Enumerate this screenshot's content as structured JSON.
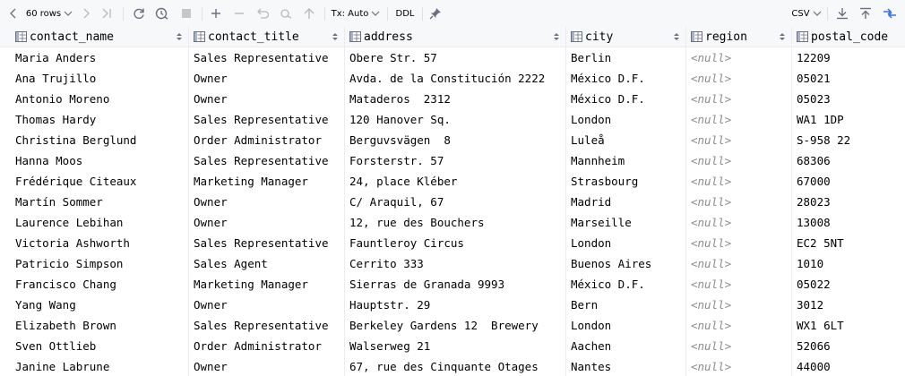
{
  "toolbar": {
    "rows_label": "60 rows",
    "tx_label": "Tx: Auto",
    "ddl_label": "DDL",
    "export_format": "CSV"
  },
  "columns": [
    {
      "name": "contact_name"
    },
    {
      "name": "contact_title"
    },
    {
      "name": "address"
    },
    {
      "name": "city"
    },
    {
      "name": "region"
    },
    {
      "name": "postal_code"
    }
  ],
  "rows": [
    [
      "Maria Anders",
      "Sales Representative",
      "Obere Str. 57",
      "Berlin",
      "<null>",
      "12209"
    ],
    [
      "Ana Trujillo",
      "Owner",
      "Avda. de la Constitución 2222",
      "México D.F.",
      "<null>",
      "05021"
    ],
    [
      "Antonio Moreno",
      "Owner",
      "Mataderos  2312",
      "México D.F.",
      "<null>",
      "05023"
    ],
    [
      "Thomas Hardy",
      "Sales Representative",
      "120 Hanover Sq.",
      "London",
      "<null>",
      "WA1 1DP"
    ],
    [
      "Christina Berglund",
      "Order Administrator",
      "Berguvsvägen  8",
      "Luleå",
      "<null>",
      "S-958 22"
    ],
    [
      "Hanna Moos",
      "Sales Representative",
      "Forsterstr. 57",
      "Mannheim",
      "<null>",
      "68306"
    ],
    [
      "Frédérique Citeaux",
      "Marketing Manager",
      "24, place Kléber",
      "Strasbourg",
      "<null>",
      "67000"
    ],
    [
      "Martín Sommer",
      "Owner",
      "C/ Araquil, 67",
      "Madrid",
      "<null>",
      "28023"
    ],
    [
      "Laurence Lebihan",
      "Owner",
      "12, rue des Bouchers",
      "Marseille",
      "<null>",
      "13008"
    ],
    [
      "Victoria Ashworth",
      "Sales Representative",
      "Fauntleroy Circus",
      "London",
      "<null>",
      "EC2 5NT"
    ],
    [
      "Patricio Simpson",
      "Sales Agent",
      "Cerrito 333",
      "Buenos Aires",
      "<null>",
      "1010"
    ],
    [
      "Francisco Chang",
      "Marketing Manager",
      "Sierras de Granada 9993",
      "México D.F.",
      "<null>",
      "05022"
    ],
    [
      "Yang Wang",
      "Owner",
      "Hauptstr. 29",
      "Bern",
      "<null>",
      "3012"
    ],
    [
      "Elizabeth Brown",
      "Sales Representative",
      "Berkeley Gardens 12  Brewery",
      "London",
      "<null>",
      "WX1 6LT"
    ],
    [
      "Sven Ottlieb",
      "Order Administrator",
      "Walserweg 21",
      "Aachen",
      "<null>",
      "52066"
    ],
    [
      "Janine Labrune",
      "Owner",
      "67, rue des Cinquante Otages",
      "Nantes",
      "<null>",
      "44000"
    ]
  ]
}
